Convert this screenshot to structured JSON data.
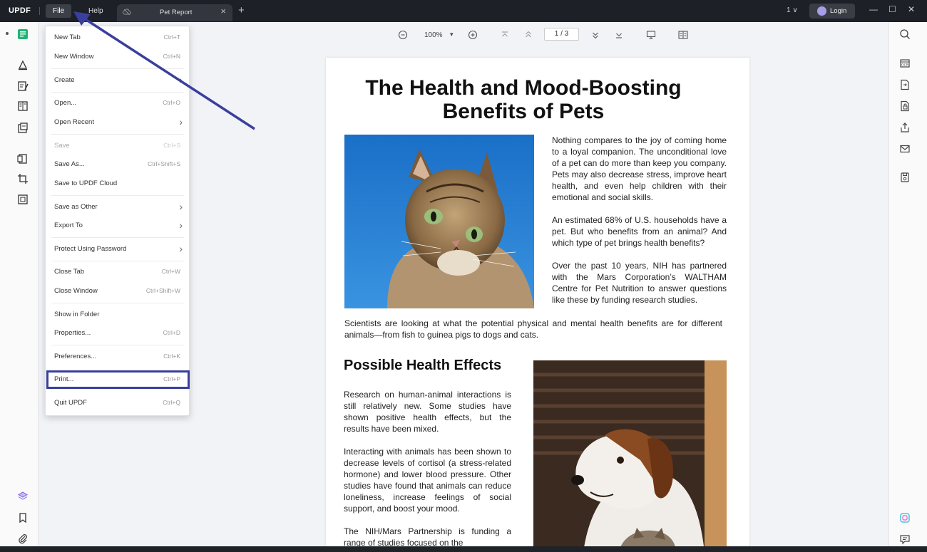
{
  "titlebar": {
    "logo": "UPDF",
    "menu_file": "File",
    "menu_help": "Help",
    "tab_title": "Pet Report",
    "tab_close": "×",
    "new_tab": "+",
    "page_count": "1 ∨",
    "login": "Login",
    "minimize": "—",
    "maximize": "☐",
    "close": "✕"
  },
  "doc_toolbar": {
    "zoom": "100%",
    "zoom_dropdown": "▾",
    "current_page": "1",
    "page_separator": "/",
    "total_pages": "3"
  },
  "file_menu": {
    "items": [
      {
        "label": "New Tab",
        "shortcut": "Ctrl+T"
      },
      {
        "label": "New Window",
        "shortcut": "Ctrl+N"
      },
      {
        "label": "Create",
        "arrow": "›"
      },
      {
        "label": "Open...",
        "shortcut": "Ctrl+O"
      },
      {
        "label": "Open Recent",
        "arrow": "›"
      },
      {
        "label": "Save",
        "shortcut": "Ctrl+S"
      },
      {
        "label": "Save As...",
        "shortcut": "Ctrl+Shift+S"
      },
      {
        "label": "Save to UPDF Cloud"
      },
      {
        "label": "Save as Other",
        "arrow": "›"
      },
      {
        "label": "Export To",
        "arrow": "›"
      },
      {
        "label": "Protect Using Password",
        "arrow": "›"
      },
      {
        "label": "Close Tab",
        "shortcut": "Ctrl+W"
      },
      {
        "label": "Close Window",
        "shortcut": "Ctrl+Shift+W"
      },
      {
        "label": "Show in Folder"
      },
      {
        "label": "Properties...",
        "shortcut": "Ctrl+D"
      },
      {
        "label": "Preferences...",
        "shortcut": "Ctrl+K"
      },
      {
        "label": "Print...",
        "shortcut": "Ctrl+P"
      },
      {
        "label": "Quit UPDF",
        "shortcut": "Ctrl+Q"
      }
    ]
  },
  "document": {
    "title_line1": "The Health and Mood-Boosting",
    "title_line2": "Benefits of Pets",
    "p1": "Nothing compares to the joy of coming home to a loyal companion. The unconditional love of a pet can do more than keep you company. Pets may also decrease stress, improve heart health, and even help children with their emotional and social skills.",
    "p2": "An estimated 68% of U.S. households have a pet. But who benefits from an animal? And which type of pet brings health benefits?",
    "p3": "Over the past 10 years, NIH has partnered with the Mars Corporation’s WALTHAM Centre for Pet Nutrition to answer questions like these by funding research studies.",
    "p4": "Scientists are looking at what the potential physical and mental health benefits are for different animals—from fish to guinea pigs to dogs and cats.",
    "h2": "Possible Health Effects",
    "p5": "Research on human-animal interactions is still relatively new. Some studies have shown positive health effects, but the results have been mixed.",
    "p6": "Interacting with animals has been shown to decrease levels of cortisol (a stress-related hormone) and lower blood pressure. Other studies have found that animals can reduce loneliness, increase feelings of social support, and boost your mood.",
    "p7": "The NIH/Mars Partnership is funding a range of studies focused on the"
  },
  "colors": {
    "titlebar_bg": "#1d2027",
    "accent_green": "#1fb573",
    "annotation_blue": "#3a3f9c"
  }
}
